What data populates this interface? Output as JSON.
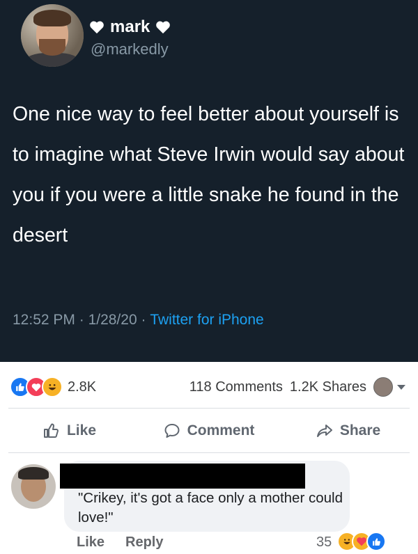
{
  "tweet": {
    "name": "mark",
    "handle": "@markedly",
    "text": "One nice way to feel better about yourself is to imagine what Steve Irwin would say about you if you were a little snake he found in the desert",
    "time": "12:52 PM",
    "date": "1/28/20",
    "source": "Twitter for iPhone",
    "sep": " · "
  },
  "facebook": {
    "reaction_count": "2.8K",
    "comments": "118 Comments",
    "shares": "1.2K Shares",
    "actions": {
      "like": "Like",
      "comment": "Comment",
      "share": "Share"
    },
    "comment": {
      "text": "\"Crikey, it's got a face only a mother could love!\"",
      "like": "Like",
      "reply": "Reply",
      "reaction_count": "35"
    }
  },
  "colors": {
    "tweet_bg": "#15202b",
    "link_blue": "#1da1f2",
    "fb_like_blue": "#1877f2",
    "love_red": "#f33e58",
    "haha_yellow": "#f7b125"
  },
  "icons": [
    "heart-icon",
    "like-thumb-icon",
    "comment-icon",
    "share-icon",
    "reaction-like-icon",
    "reaction-love-icon",
    "reaction-haha-icon"
  ]
}
